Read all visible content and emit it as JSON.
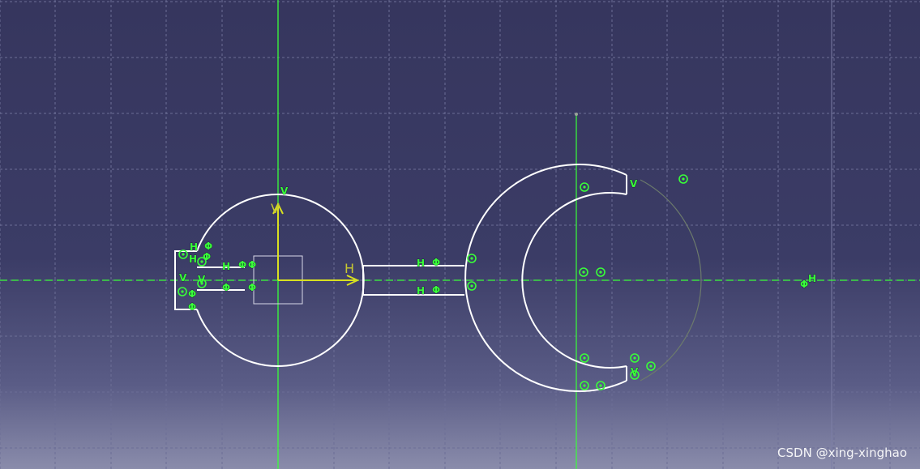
{
  "sketch": {
    "axis_labels": {
      "h": "H",
      "v": "V"
    },
    "constraint_symbols": {
      "horizontal": "H",
      "vertical": "V",
      "fix": "Φ",
      "tangent_circle": "⊙"
    },
    "colors": {
      "background": "#3b3c66",
      "grid": "#6c6e96",
      "geometry": "#ffffff",
      "axes": "#39ff39",
      "symbol": "#39ff39",
      "axis_arrow": "#d8e020",
      "construction": "#6c7a6c"
    }
  },
  "watermark": "CSDN @xing-xinghao"
}
